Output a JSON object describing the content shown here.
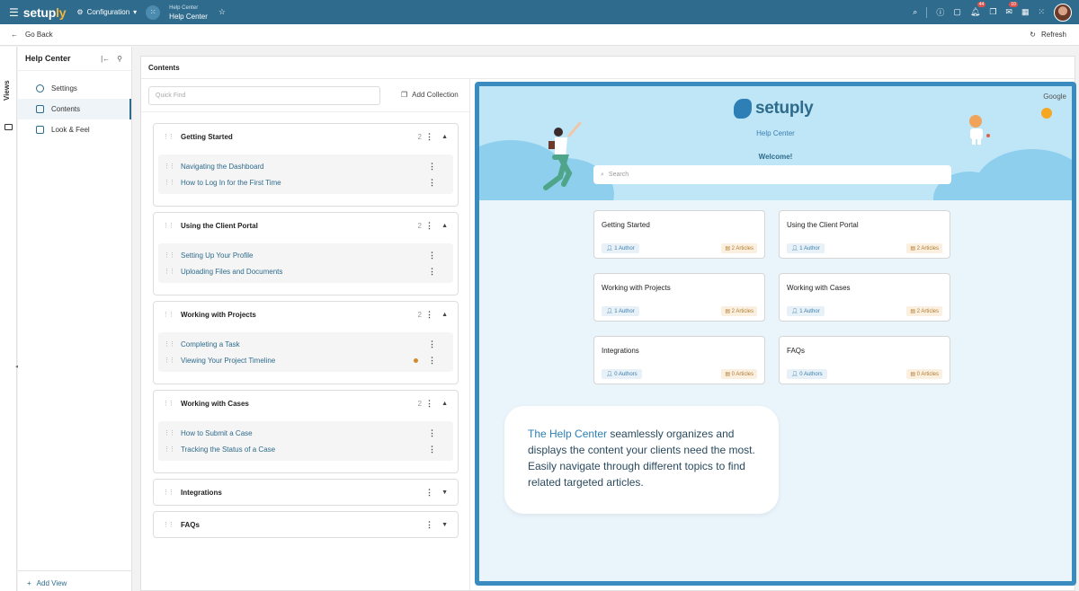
{
  "topbar": {
    "brand_a": "setup",
    "brand_b": "ly",
    "config_label": "Configuration",
    "page_small": "Help Center",
    "page_big": "Help Center",
    "badge_a": "44",
    "badge_b": "10"
  },
  "backbar": {
    "go_back": "Go Back",
    "refresh": "Refresh"
  },
  "views": {
    "label": "Views"
  },
  "leftpanel": {
    "title": "Help Center",
    "items": [
      {
        "label": "Settings"
      },
      {
        "label": "Contents"
      },
      {
        "label": "Look & Feel"
      }
    ],
    "add_view": "Add View"
  },
  "contents": {
    "title": "Contents",
    "quickfind_placeholder": "Quick Find",
    "add_collection": "Add Collection",
    "collections": [
      {
        "title": "Getting Started",
        "count": "2",
        "articles": [
          "Navigating the Dashboard",
          "How to Log In for the First Time"
        ]
      },
      {
        "title": "Using the Client Portal",
        "count": "2",
        "articles": [
          "Setting Up Your Profile",
          "Uploading Files and Documents"
        ]
      },
      {
        "title": "Working with Projects",
        "count": "2",
        "articles": [
          "Completing a Task",
          "Viewing Your Project Timeline"
        ]
      },
      {
        "title": "Working with Cases",
        "count": "2",
        "articles": [
          "How to Submit a Case",
          "Tracking the Status of a Case"
        ]
      },
      {
        "title": "Integrations"
      },
      {
        "title": "FAQs"
      }
    ]
  },
  "preview": {
    "google": "Google",
    "logo": "setuply",
    "subtitle": "Help Center",
    "welcome": "Welcome!",
    "search_placeholder": "Search",
    "cards": [
      {
        "title": "Getting Started",
        "authors": "1 Author",
        "articles": "2 Articles"
      },
      {
        "title": "Using the Client Portal",
        "authors": "1 Author",
        "articles": "2 Articles"
      },
      {
        "title": "Working with Projects",
        "authors": "1 Author",
        "articles": "2 Articles"
      },
      {
        "title": "Working with Cases",
        "authors": "1 Author",
        "articles": "2 Articles"
      },
      {
        "title": "Integrations",
        "authors": "0 Authors",
        "articles": "0 Articles"
      },
      {
        "title": "FAQs",
        "authors": "0 Authors",
        "articles": "0 Articles"
      }
    ],
    "bubble_highlight": "The Help Center",
    "bubble_text": " seamlessly organizes and displays the content your clients need the most. Easily navigate through different topics to find related targeted articles."
  },
  "colors": {
    "primary": "#2e6b8c",
    "accent": "#f5b43a",
    "preview_border": "#3a8cc0"
  }
}
